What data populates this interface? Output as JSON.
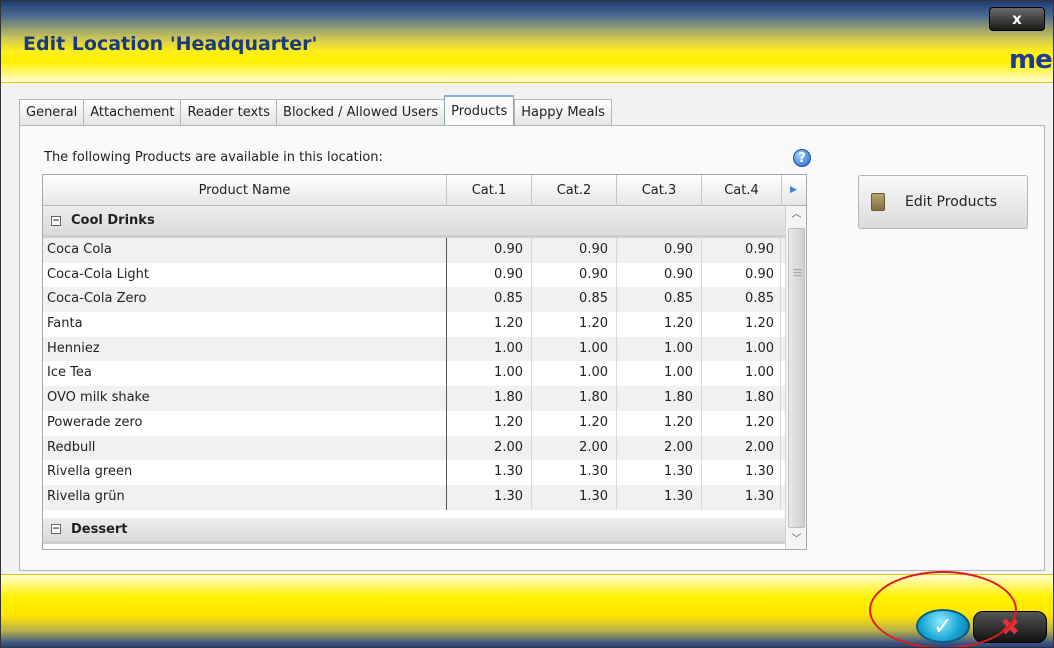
{
  "window": {
    "title": "Edit Location 'Headquarter'",
    "close_label": "x",
    "logo_text": "mei"
  },
  "tabs": [
    {
      "label": "General",
      "active": false
    },
    {
      "label": "Attachement",
      "active": false
    },
    {
      "label": "Reader texts",
      "active": false
    },
    {
      "label": "Blocked / Allowed Users",
      "active": false
    },
    {
      "label": "Products",
      "active": true
    },
    {
      "label": "Happy Meals",
      "active": false
    }
  ],
  "products_panel": {
    "info_text": "The following Products are available in this location:",
    "help_icon": "?",
    "edit_button_label": "Edit Products"
  },
  "grid": {
    "columns": [
      "Product Name",
      "Cat.1",
      "Cat.2",
      "Cat.3",
      "Cat.4"
    ],
    "groups": [
      {
        "name": "Cool Drinks",
        "rows": [
          [
            "Coca Cola",
            "0.90",
            "0.90",
            "0.90",
            "0.90"
          ],
          [
            "Coca-Cola Light",
            "0.90",
            "0.90",
            "0.90",
            "0.90"
          ],
          [
            "Coca-Cola Zero",
            "0.85",
            "0.85",
            "0.85",
            "0.85"
          ],
          [
            "Fanta",
            "1.20",
            "1.20",
            "1.20",
            "1.20"
          ],
          [
            "Henniez",
            "1.00",
            "1.00",
            "1.00",
            "1.00"
          ],
          [
            "Ice Tea",
            "1.00",
            "1.00",
            "1.00",
            "1.00"
          ],
          [
            "OVO milk shake",
            "1.80",
            "1.80",
            "1.80",
            "1.80"
          ],
          [
            "Powerade zero",
            "1.20",
            "1.20",
            "1.20",
            "1.20"
          ],
          [
            "Redbull",
            "2.00",
            "2.00",
            "2.00",
            "2.00"
          ],
          [
            "Rivella green",
            "1.30",
            "1.30",
            "1.30",
            "1.30"
          ],
          [
            "Rivella grün",
            "1.30",
            "1.30",
            "1.30",
            "1.30"
          ]
        ]
      },
      {
        "name": "Dessert",
        "rows": []
      }
    ]
  },
  "footer": {
    "ok_symbol": "✓",
    "cancel_symbol": "✖"
  },
  "colors": {
    "header_yellow": "#fff200",
    "title_blue": "#1a3a7a",
    "ok_cyan": "#1aa9d6",
    "highlight_red": "#e01b1b"
  }
}
